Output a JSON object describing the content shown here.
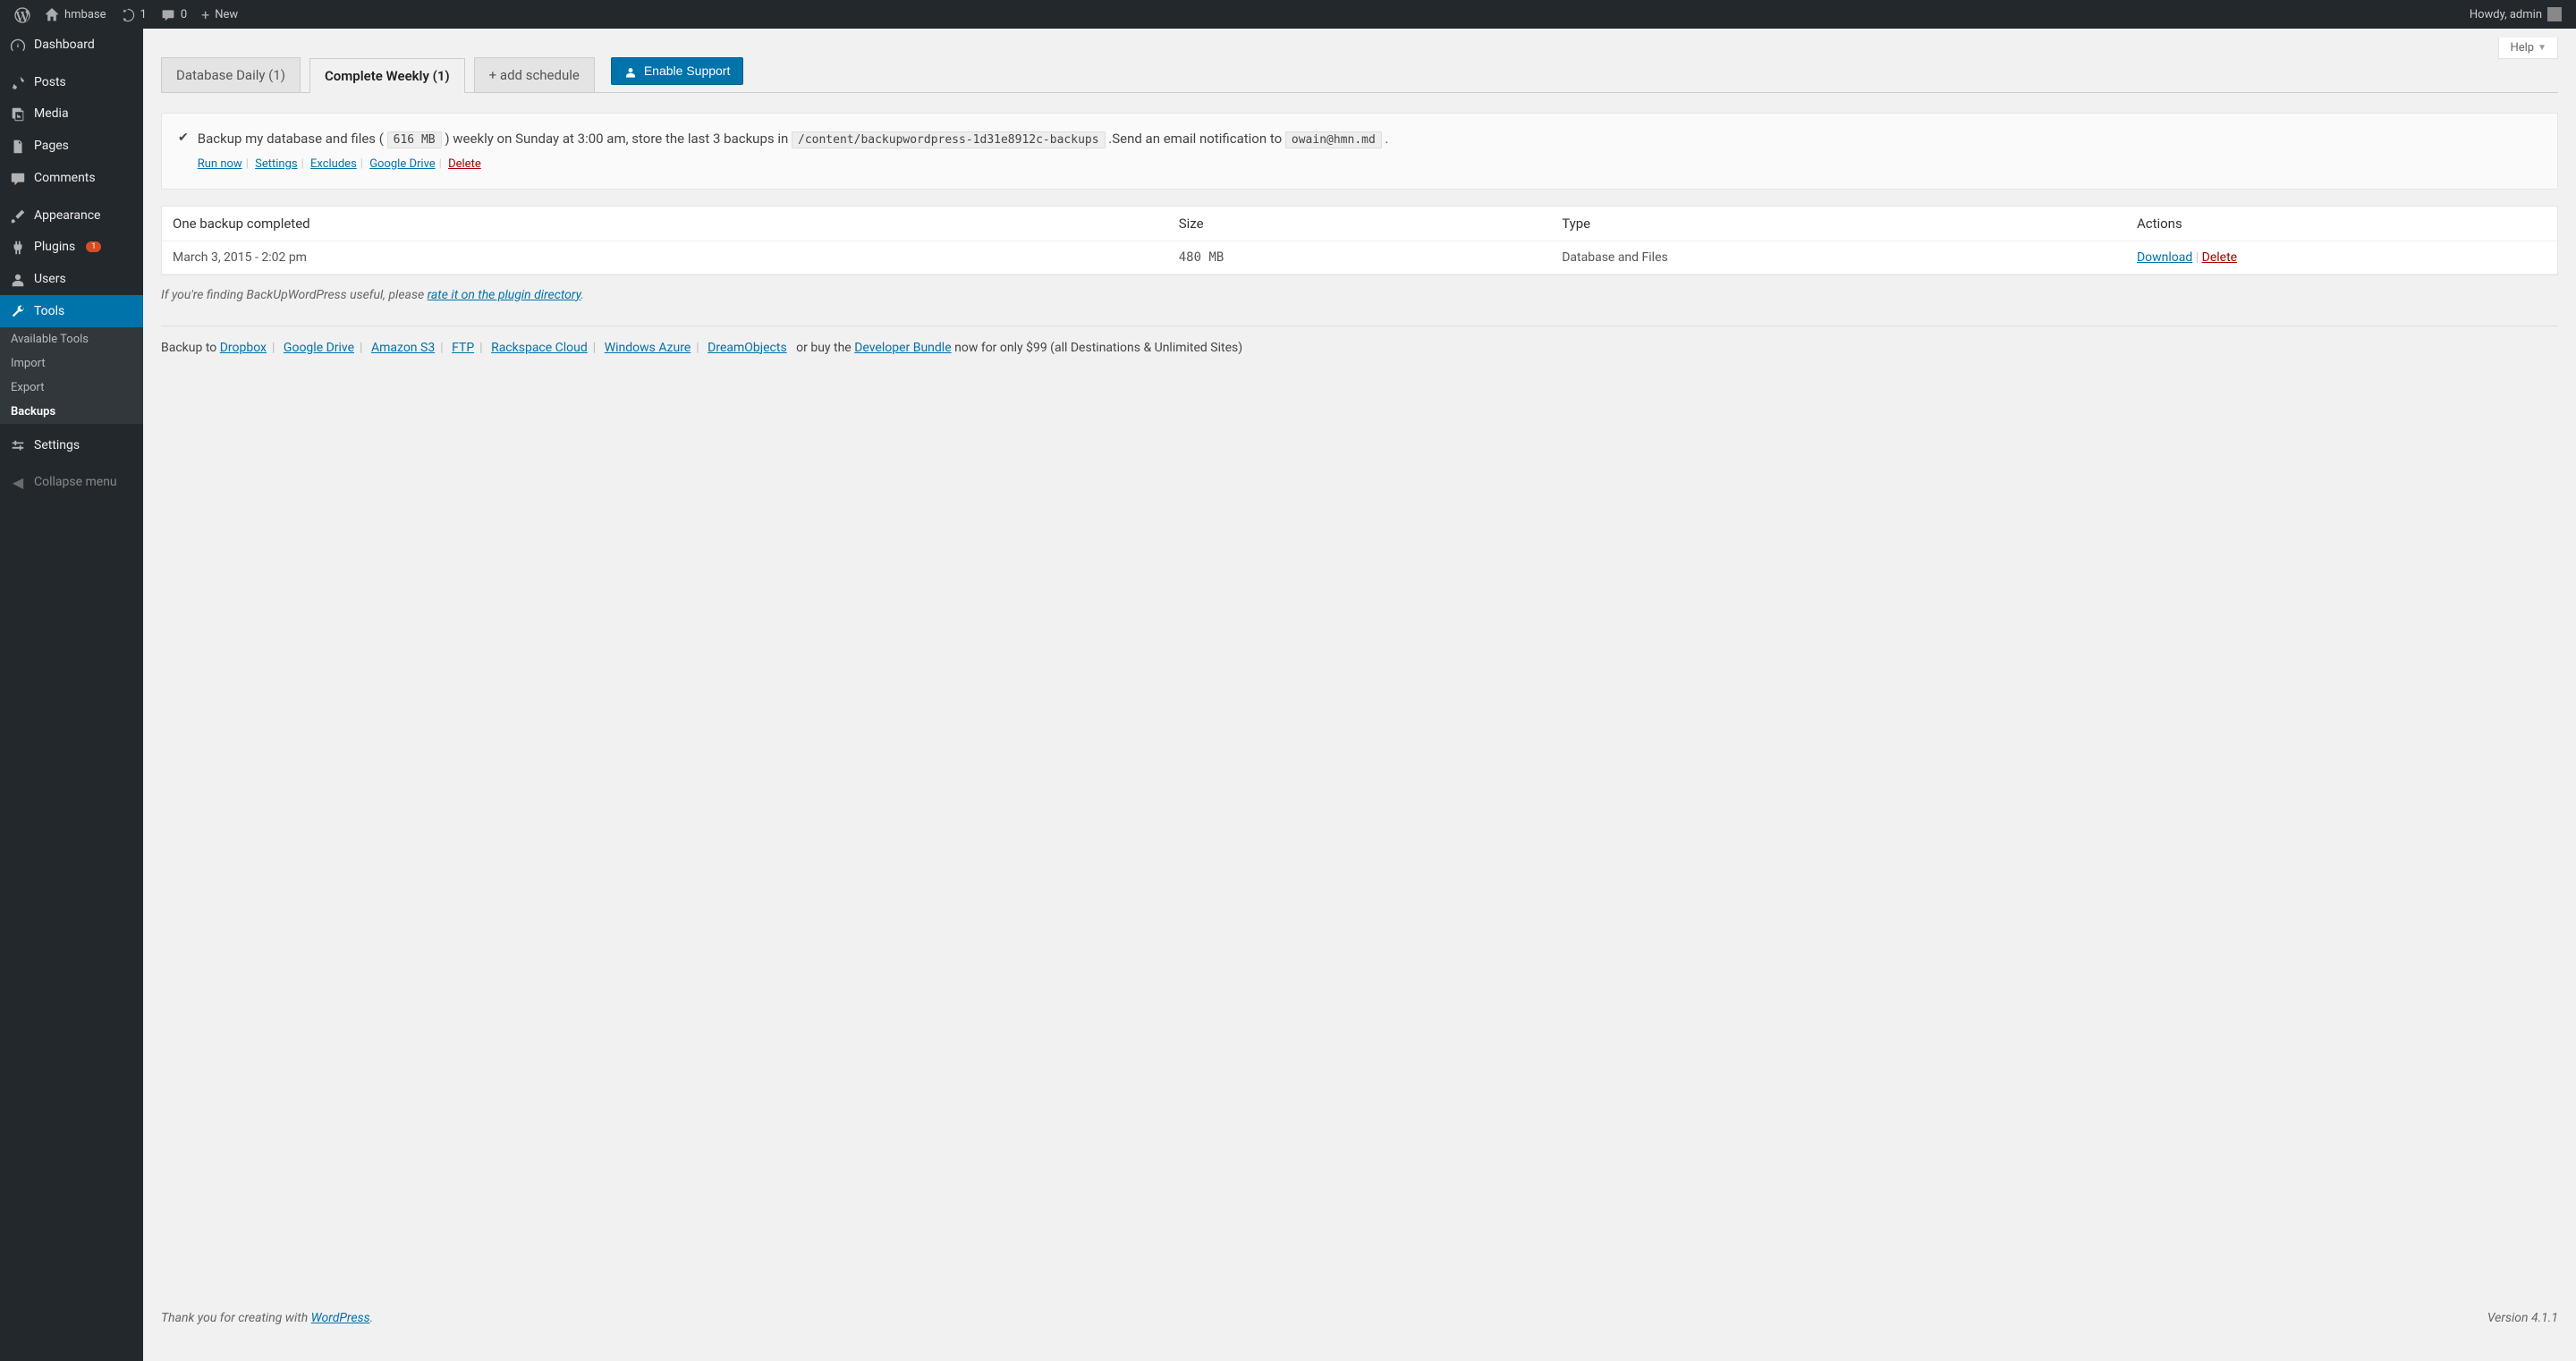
{
  "adminbar": {
    "site_name": "hmbase",
    "updates_count": "1",
    "comments_count": "0",
    "new_label": "New",
    "howdy": "Howdy, admin"
  },
  "sidebar": {
    "items": [
      {
        "label": "Dashboard",
        "icon": "dashboard"
      },
      {
        "label": "Posts",
        "icon": "pin"
      },
      {
        "label": "Media",
        "icon": "media"
      },
      {
        "label": "Pages",
        "icon": "page"
      },
      {
        "label": "Comments",
        "icon": "comment"
      },
      {
        "label": "Appearance",
        "icon": "brush"
      },
      {
        "label": "Plugins",
        "icon": "plug",
        "badge": "1"
      },
      {
        "label": "Users",
        "icon": "user"
      },
      {
        "label": "Tools",
        "icon": "wrench",
        "current": true
      },
      {
        "label": "Settings",
        "icon": "sliders"
      },
      {
        "label": "Collapse menu",
        "icon": "collapse"
      }
    ],
    "submenu": [
      {
        "label": "Available Tools"
      },
      {
        "label": "Import"
      },
      {
        "label": "Export"
      },
      {
        "label": "Backups",
        "current": true
      }
    ]
  },
  "help_label": "Help",
  "tabs": {
    "items": [
      {
        "label": "Database Daily (1)"
      },
      {
        "label": "Complete Weekly (1)",
        "active": true
      },
      {
        "label": "+ add schedule",
        "add": true
      }
    ],
    "enable_support": "Enable Support"
  },
  "infobox": {
    "text_pre": "Backup my database and files (",
    "size": "616 MB",
    "text_mid1": ") weekly on Sunday at 3:00 am, store the last 3 backups in",
    "path": "/content/backupwordpress-1d31e8912c-backups",
    "text_mid2": ".Send an email notification to",
    "email": "owain@hmn.md",
    "text_end": ".",
    "links": [
      {
        "label": "Run now"
      },
      {
        "label": "Settings"
      },
      {
        "label": "Excludes"
      },
      {
        "label": "Google Drive"
      },
      {
        "label": "Delete",
        "danger": true
      }
    ]
  },
  "table": {
    "headers": {
      "status": "One backup completed",
      "size": "Size",
      "type": "Type",
      "actions": "Actions"
    },
    "rows": [
      {
        "date": "March 3, 2015 - 2:02 pm",
        "size": "480 MB",
        "type": "Database and Files",
        "download": "Download",
        "delete": "Delete"
      }
    ]
  },
  "hint": {
    "pre": "If you're finding BackUpWordPress useful, please ",
    "link": "rate it on the plugin directory",
    "post": "."
  },
  "destinations": {
    "prefix": "Backup to ",
    "items": [
      "Dropbox",
      "Google Drive",
      "Amazon S3",
      "FTP",
      "Rackspace Cloud",
      "Windows Azure",
      "DreamObjects"
    ],
    "or_buy": " or buy the ",
    "bundle": "Developer Bundle",
    "tail": " now for only $99 (all Destinations & Unlimited Sites)"
  },
  "footer": {
    "thankyou_pre": "Thank you for creating with ",
    "thankyou_link": "WordPress",
    "thankyou_post": ".",
    "version": "Version 4.1.1"
  }
}
